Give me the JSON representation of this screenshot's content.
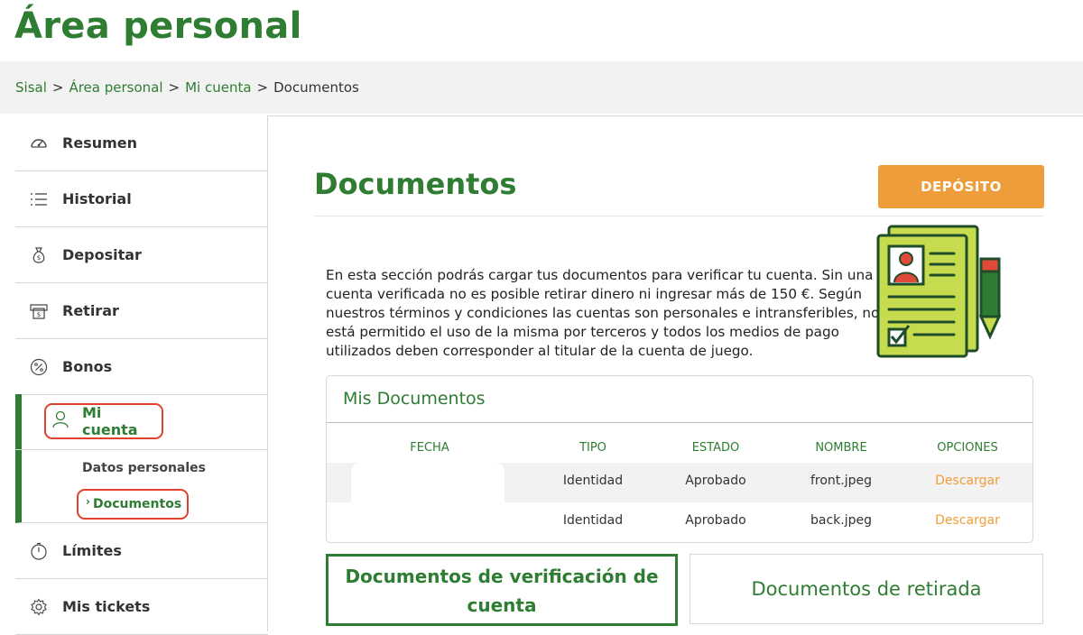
{
  "page_title": "Área personal",
  "breadcrumb": {
    "items": [
      "Sisal",
      "Área personal",
      "Mi cuenta"
    ],
    "separator": ">",
    "current": "Documentos"
  },
  "sidebar": {
    "items": [
      {
        "label": "Resumen",
        "icon": "speedometer-icon"
      },
      {
        "label": "Historial",
        "icon": "list-icon"
      },
      {
        "label": "Depositar",
        "icon": "money-bag-icon"
      },
      {
        "label": "Retirar",
        "icon": "atm-icon"
      },
      {
        "label": "Bonos",
        "icon": "percent-icon"
      },
      {
        "label": "Mi cuenta",
        "icon": "user-icon"
      },
      {
        "label": "Límites",
        "icon": "stopwatch-icon"
      },
      {
        "label": "Mis tickets",
        "icon": "gear-icon"
      }
    ],
    "subitems": [
      {
        "label": "Datos personales"
      },
      {
        "label": "Documentos",
        "chevron": "›"
      }
    ]
  },
  "main": {
    "title": "Documentos",
    "deposit_label": "DEPÓSITO",
    "intro": "En esta sección podrás cargar tus documentos para verificar tu cuenta. Sin una cuenta verificada no es posible retirar dinero ni ingresar más de 150 €. Según nuestros términos y condiciones las cuentas son personales e intransferibles, no está permitido el uso de la misma por terceros y todos los medios de pago utilizados deben corresponder al titular de la cuenta de juego.",
    "documents_panel": {
      "title": "Mis Documentos",
      "columns": [
        "FECHA",
        "TIPO",
        "ESTADO",
        "NOMBRE",
        "OPCIONES"
      ],
      "rows": [
        {
          "fecha": "",
          "tipo": "Identidad",
          "estado": "Aprobado",
          "nombre": "front.jpeg",
          "opciones": "Descargar"
        },
        {
          "fecha": "",
          "tipo": "Identidad",
          "estado": "Aprobado",
          "nombre": "back.jpeg",
          "opciones": "Descargar"
        }
      ]
    },
    "verification_docs_label": "Documentos de verificación de cuenta",
    "withdrawal_docs_label": "Documentos de retirada"
  },
  "colors": {
    "brand_green": "#2e7d32",
    "accent_orange": "#ef9d3a",
    "highlight_red": "#e0422e",
    "illustration_lime": "#c6dc4e"
  }
}
